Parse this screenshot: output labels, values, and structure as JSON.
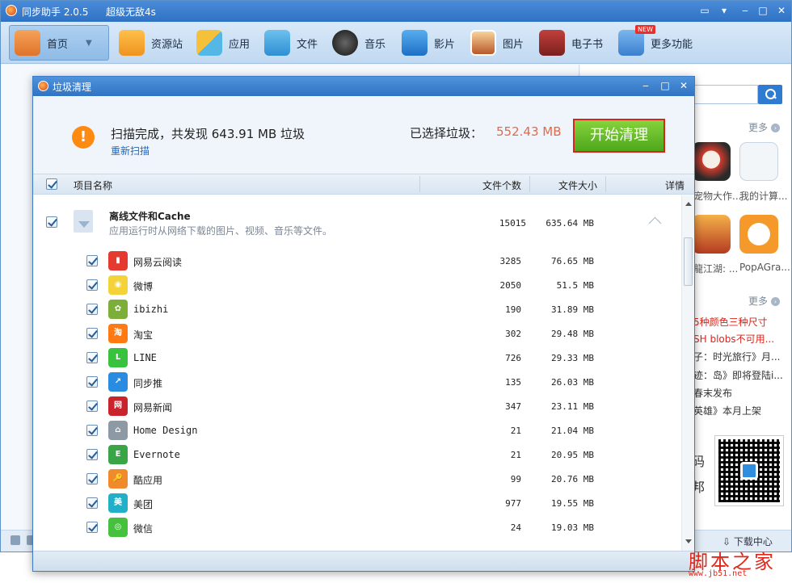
{
  "app": {
    "title": "同步助手 2.0.5",
    "device": "超级无敌4s"
  },
  "toolbar": {
    "items": [
      {
        "label": "首页",
        "icon": "home-icon",
        "color": "#e8852e"
      },
      {
        "label": "资源站",
        "icon": "resource-store-icon",
        "color": "#f0a422"
      },
      {
        "label": "应用",
        "icon": "apps-icon",
        "color": "#2f9ad6"
      },
      {
        "label": "文件",
        "icon": "files-icon",
        "color": "#3fa5e0"
      },
      {
        "label": "音乐",
        "icon": "music-icon",
        "color": "#333333"
      },
      {
        "label": "影片",
        "icon": "video-icon",
        "color": "#2d86d8"
      },
      {
        "label": "图片",
        "icon": "photo-icon",
        "color": "#d0762d"
      },
      {
        "label": "电子书",
        "icon": "ebook-icon",
        "color": "#a22c2c"
      },
      {
        "label": "更多功能",
        "icon": "more-tools-icon",
        "color": "#4a90d9",
        "badge": "NEW"
      }
    ]
  },
  "right_panel": {
    "more1": "更多",
    "more2": "更多",
    "apps": [
      "宠物大作...",
      "我的计算...",
      "龍江湖: ...",
      "PopAGra..."
    ],
    "news": [
      "5种颜色三种尺寸",
      "SH blobs不可用...",
      "子：时光旅行》月...",
      "迹：岛》即将登陆i...",
      "春末发布",
      "英雄》本月上架"
    ],
    "qr_side": [
      "码",
      "邦"
    ],
    "download": "下载中心"
  },
  "dialog": {
    "title": "垃圾清理",
    "scan_message": "扫描完成，共发现 643.91 MB 垃圾",
    "rescan": "重新扫描",
    "selected_label": "已选择垃圾：",
    "selected_value": "552.43 MB",
    "start_button": "开始清理",
    "columns": {
      "name": "项目名称",
      "count": "文件个数",
      "size": "文件大小",
      "detail": "详情"
    },
    "group": {
      "name": "离线文件和Cache",
      "desc": "应用运行时从网络下载的图片、视频、音乐等文件。",
      "count": "15015",
      "size": "635.64 MB"
    },
    "rows": [
      {
        "name": "网易云阅读",
        "count": "3285",
        "size": "76.65 MB",
        "color": "#e53a2f",
        "glyph": "▮"
      },
      {
        "name": "微博",
        "count": "2050",
        "size": "51.5 MB",
        "color": "#f3d23a",
        "glyph": "◉"
      },
      {
        "name": "ibizhi",
        "count": "190",
        "size": "31.89 MB",
        "color": "#7cae3a",
        "glyph": "✿"
      },
      {
        "name": "淘宝",
        "count": "302",
        "size": "29.48 MB",
        "color": "#ff7a12",
        "glyph": "淘"
      },
      {
        "name": "LINE",
        "count": "726",
        "size": "29.33 MB",
        "color": "#38c23d",
        "glyph": "L"
      },
      {
        "name": "同步推",
        "count": "135",
        "size": "26.03 MB",
        "color": "#2a8ce0",
        "glyph": "↗"
      },
      {
        "name": "网易新闻",
        "count": "347",
        "size": "23.11 MB",
        "color": "#c9232c",
        "glyph": "网"
      },
      {
        "name": "Home Design",
        "count": "21",
        "size": "21.04 MB",
        "color": "#8e99a6",
        "glyph": "⌂"
      },
      {
        "name": "Evernote",
        "count": "21",
        "size": "20.95 MB",
        "color": "#3aa546",
        "glyph": "E"
      },
      {
        "name": "酷应用",
        "count": "99",
        "size": "20.76 MB",
        "color": "#f08a2a",
        "glyph": "🔑"
      },
      {
        "name": "美团",
        "count": "977",
        "size": "19.55 MB",
        "color": "#22b0c9",
        "glyph": "美"
      },
      {
        "name": "微信",
        "count": "24",
        "size": "19.03 MB",
        "color": "#46c03f",
        "glyph": "◎"
      }
    ]
  },
  "watermark": {
    "text": "脚本之家",
    "url": "www.jb51.net"
  }
}
